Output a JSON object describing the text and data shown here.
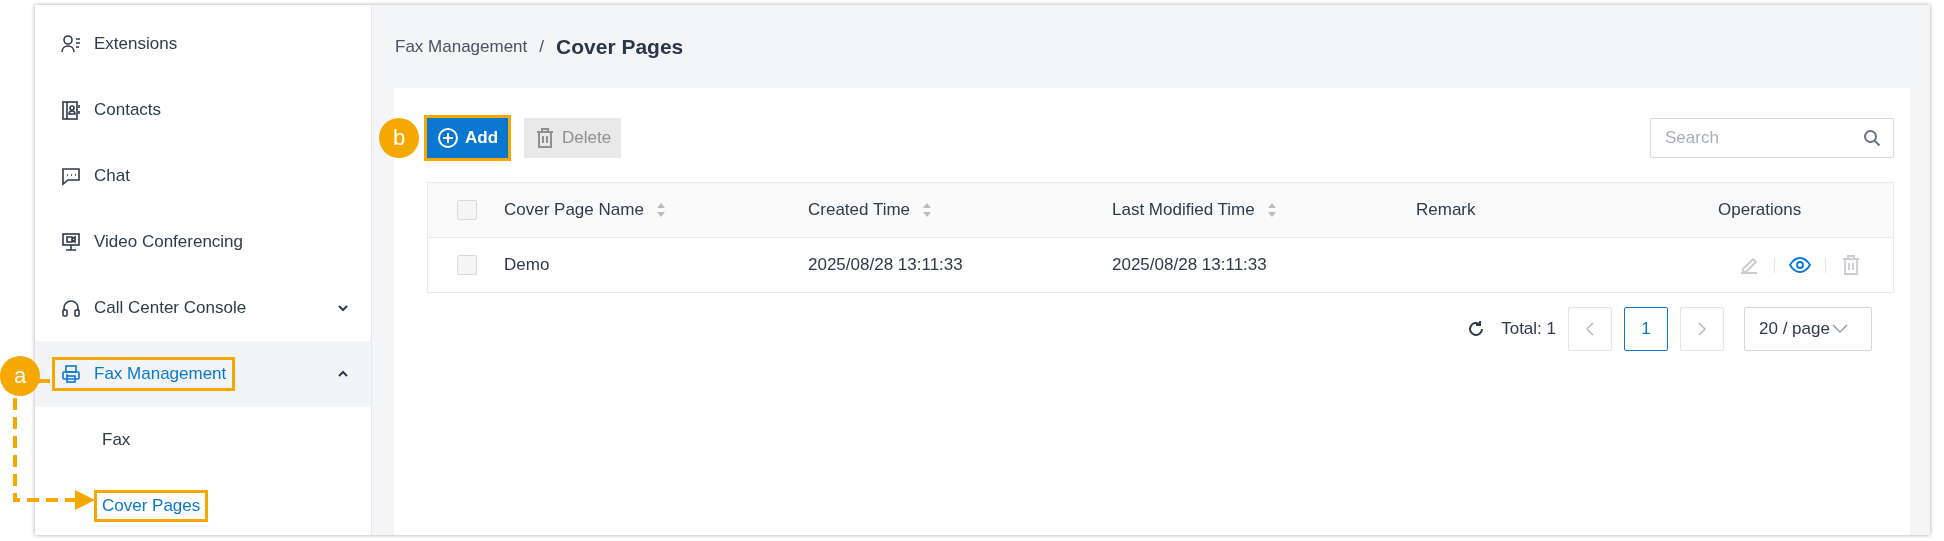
{
  "sidebar": {
    "items": [
      {
        "label": "Extensions",
        "kind": "item",
        "selected": false
      },
      {
        "label": "Contacts",
        "kind": "item",
        "selected": false
      },
      {
        "label": "Chat",
        "kind": "item",
        "selected": false
      },
      {
        "label": "Video Conferencing",
        "kind": "item",
        "selected": false
      },
      {
        "label": "Call Center Console",
        "kind": "group",
        "expanded": false,
        "selected": false
      },
      {
        "label": "Fax Management",
        "kind": "group",
        "expanded": true,
        "selected": true,
        "annotated": true,
        "children": [
          {
            "label": "Fax",
            "selected": false,
            "annotated": false
          },
          {
            "label": "Cover Pages",
            "selected": true,
            "annotated": true
          }
        ]
      }
    ]
  },
  "breadcrumb": {
    "parent": "Fax Management",
    "separator": "/",
    "current": "Cover Pages"
  },
  "toolbar": {
    "buttons": [
      {
        "label": "Add",
        "kind": "add",
        "disabled": false,
        "annotated": true
      },
      {
        "label": "Delete",
        "kind": "delete",
        "disabled": true,
        "annotated": false
      }
    ],
    "search": {
      "placeholder": "Search"
    }
  },
  "table": {
    "all_checked": false,
    "columns": [
      {
        "label": "Cover Page Name",
        "sortable": true
      },
      {
        "label": "Created Time",
        "sortable": true
      },
      {
        "label": "Last Modified Time",
        "sortable": true
      },
      {
        "label": "Remark",
        "sortable": false
      },
      {
        "label": "Operations",
        "sortable": false
      }
    ],
    "rows": [
      {
        "checked": false,
        "cells": [
          "Demo",
          "2025/08/28 13:11:33",
          "2025/08/28 13:11:33"
        ],
        "operations": [
          {
            "kind": "edit",
            "disabled": true
          },
          {
            "kind": "view",
            "disabled": false
          },
          {
            "kind": "delete",
            "disabled": true
          }
        ]
      }
    ]
  },
  "pagination": {
    "total": "Total: 1",
    "pages": [
      {
        "label": "1",
        "selected": true
      }
    ],
    "prev_disabled": true,
    "next_disabled": true,
    "page_size": "20 / page"
  },
  "callouts": [
    {
      "label": "a"
    },
    {
      "label": "b"
    }
  ]
}
